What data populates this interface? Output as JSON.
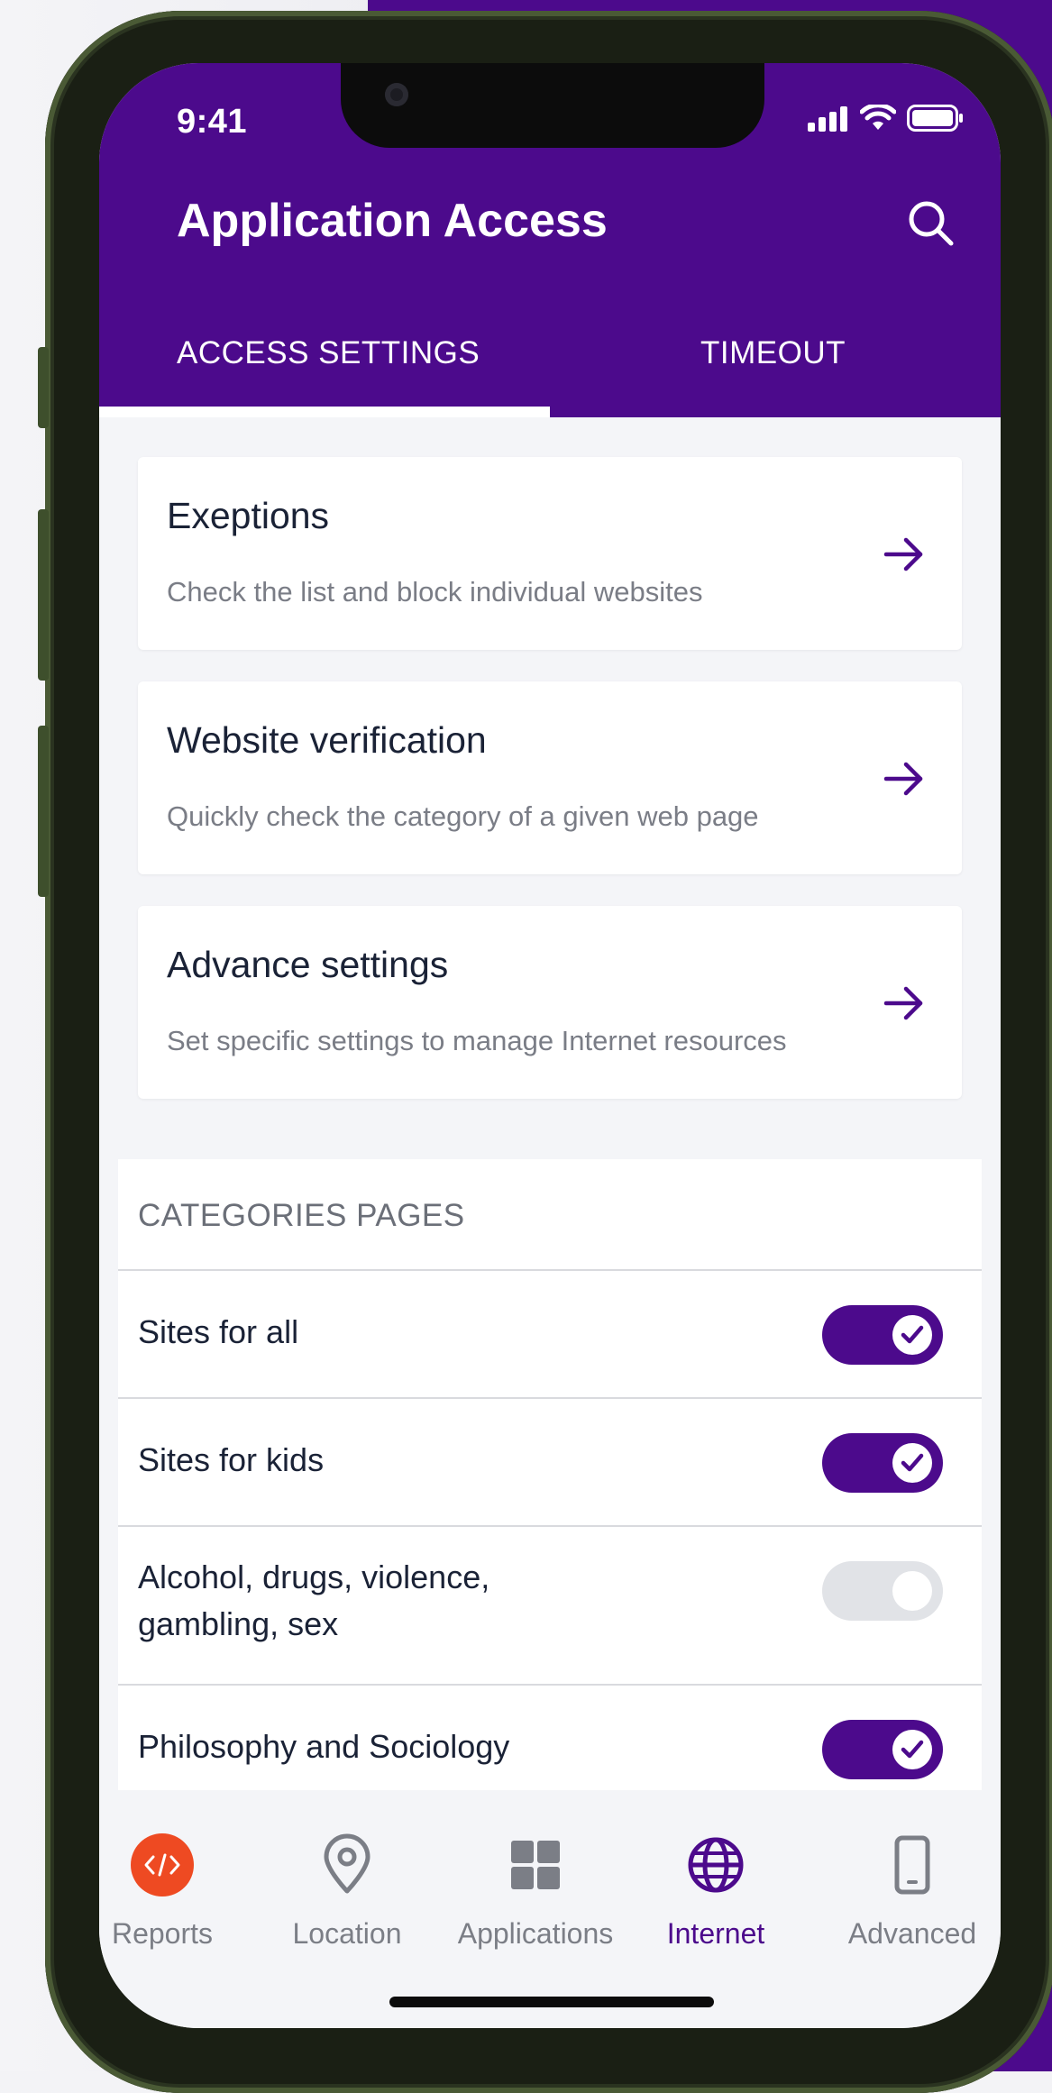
{
  "status": {
    "time": "9:41"
  },
  "header": {
    "title": "Application Access"
  },
  "tabs": [
    {
      "label": "ACCESS SETTINGS",
      "active": true
    },
    {
      "label": "TIMEOUT",
      "active": false
    }
  ],
  "cards": [
    {
      "title": "Exeptions",
      "subtitle": "Check the list and block individual websites"
    },
    {
      "title": "Website verification",
      "subtitle": "Quickly check the category of a given web page"
    },
    {
      "title": "Advance settings",
      "subtitle": "Set specific settings to manage Internet resources"
    }
  ],
  "categories": {
    "header": "CATEGORIES PAGES",
    "items": [
      {
        "label": "Sites for all",
        "enabled": true
      },
      {
        "label": "Sites for kids",
        "enabled": true
      },
      {
        "label": "Alcohol, drugs, violence,",
        "label_line2": "gambling, sex",
        "enabled": false
      },
      {
        "label": "Philosophy and Sociology",
        "enabled": true
      }
    ]
  },
  "nav": {
    "items": [
      {
        "label": "Reports",
        "icon": "code-icon"
      },
      {
        "label": "Location",
        "icon": "location-pin-icon"
      },
      {
        "label": "Applications",
        "icon": "grid-icon"
      },
      {
        "label": "Internet",
        "icon": "globe-icon",
        "active": true
      },
      {
        "label": "Advanced",
        "icon": "phone-icon"
      }
    ]
  },
  "colors": {
    "primary": "#4c0a8c",
    "reports_badge": "#ee4a22",
    "text_dark": "#1a2236",
    "text_muted": "#7a7d86",
    "toggle_off": "#e1e3e7"
  }
}
